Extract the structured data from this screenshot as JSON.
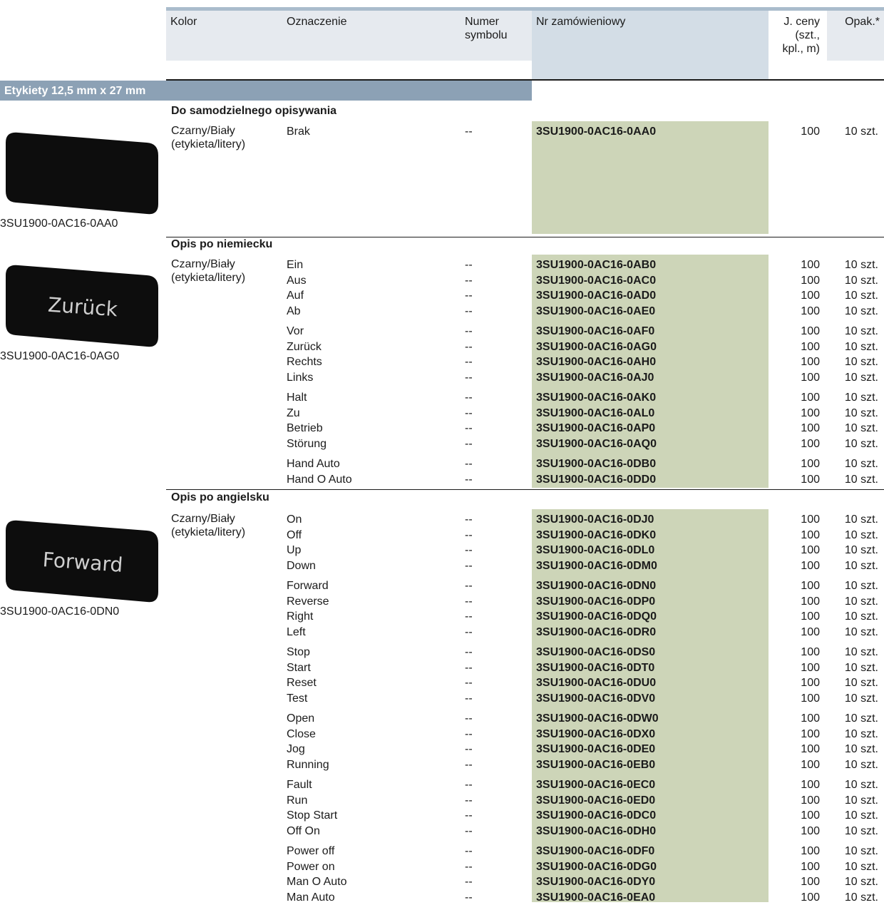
{
  "header": {
    "kolor": "Kolor",
    "oznaczenie": "Oznaczenie",
    "numer_symbolu": [
      "Numer",
      "symbolu"
    ],
    "nr_zamowieniowy": "Nr zamówieniowy",
    "j_ceny": [
      "J. ceny",
      "(szt.,",
      "kpl., m)"
    ],
    "opak": "Opak.*"
  },
  "band_title": "Etykiety 12,5 mm x 27 mm",
  "sections": [
    {
      "title": "Do samodzielnego opisywania",
      "kolor": [
        "Czarny/Biały",
        "(etykieta/litery)"
      ],
      "image_caption": "3SU1900-0AC16-0AA0",
      "image_text": "",
      "groups": [
        [
          {
            "oznaczenie": "Brak",
            "numer": "--",
            "nr": "3SU1900-0AC16-0AA0",
            "cena": "100",
            "opak": "10 szt."
          }
        ]
      ]
    },
    {
      "title": "Opis po niemiecku",
      "kolor": [
        "Czarny/Biały",
        "(etykieta/litery)"
      ],
      "image_caption": "3SU1900-0AC16-0AG0",
      "image_text": "Zurück",
      "groups": [
        [
          {
            "oznaczenie": "Ein",
            "numer": "--",
            "nr": "3SU1900-0AC16-0AB0",
            "cena": "100",
            "opak": "10 szt."
          },
          {
            "oznaczenie": "Aus",
            "numer": "--",
            "nr": "3SU1900-0AC16-0AC0",
            "cena": "100",
            "opak": "10 szt."
          },
          {
            "oznaczenie": "Auf",
            "numer": "--",
            "nr": "3SU1900-0AC16-0AD0",
            "cena": "100",
            "opak": "10 szt."
          },
          {
            "oznaczenie": "Ab",
            "numer": "--",
            "nr": "3SU1900-0AC16-0AE0",
            "cena": "100",
            "opak": "10 szt."
          }
        ],
        [
          {
            "oznaczenie": "Vor",
            "numer": "--",
            "nr": "3SU1900-0AC16-0AF0",
            "cena": "100",
            "opak": "10 szt."
          },
          {
            "oznaczenie": "Zurück",
            "numer": "--",
            "nr": "3SU1900-0AC16-0AG0",
            "cena": "100",
            "opak": "10 szt."
          },
          {
            "oznaczenie": "Rechts",
            "numer": "--",
            "nr": "3SU1900-0AC16-0AH0",
            "cena": "100",
            "opak": "10 szt."
          },
          {
            "oznaczenie": "Links",
            "numer": "--",
            "nr": "3SU1900-0AC16-0AJ0",
            "cena": "100",
            "opak": "10 szt."
          }
        ],
        [
          {
            "oznaczenie": "Halt",
            "numer": "--",
            "nr": "3SU1900-0AC16-0AK0",
            "cena": "100",
            "opak": "10 szt."
          },
          {
            "oznaczenie": "Zu",
            "numer": "--",
            "nr": "3SU1900-0AC16-0AL0",
            "cena": "100",
            "opak": "10 szt."
          },
          {
            "oznaczenie": "Betrieb",
            "numer": "--",
            "nr": "3SU1900-0AC16-0AP0",
            "cena": "100",
            "opak": "10 szt."
          },
          {
            "oznaczenie": "Störung",
            "numer": "--",
            "nr": "3SU1900-0AC16-0AQ0",
            "cena": "100",
            "opak": "10 szt."
          }
        ],
        [
          {
            "oznaczenie": "Hand Auto",
            "numer": "--",
            "nr": "3SU1900-0AC16-0DB0",
            "cena": "100",
            "opak": "10 szt."
          },
          {
            "oznaczenie": "Hand O Auto",
            "numer": "--",
            "nr": "3SU1900-0AC16-0DD0",
            "cena": "100",
            "opak": "10 szt."
          }
        ]
      ]
    },
    {
      "title": "Opis po angielsku",
      "kolor": [
        "Czarny/Biały",
        "(etykieta/litery)"
      ],
      "image_caption": "3SU1900-0AC16-0DN0",
      "image_text": "Forward",
      "groups": [
        [
          {
            "oznaczenie": "On",
            "numer": "--",
            "nr": "3SU1900-0AC16-0DJ0",
            "cena": "100",
            "opak": "10 szt."
          },
          {
            "oznaczenie": "Off",
            "numer": "--",
            "nr": "3SU1900-0AC16-0DK0",
            "cena": "100",
            "opak": "10 szt."
          },
          {
            "oznaczenie": "Up",
            "numer": "--",
            "nr": "3SU1900-0AC16-0DL0",
            "cena": "100",
            "opak": "10 szt."
          },
          {
            "oznaczenie": "Down",
            "numer": "--",
            "nr": "3SU1900-0AC16-0DM0",
            "cena": "100",
            "opak": "10 szt."
          }
        ],
        [
          {
            "oznaczenie": "Forward",
            "numer": "--",
            "nr": "3SU1900-0AC16-0DN0",
            "cena": "100",
            "opak": "10 szt."
          },
          {
            "oznaczenie": "Reverse",
            "numer": "--",
            "nr": "3SU1900-0AC16-0DP0",
            "cena": "100",
            "opak": "10 szt."
          },
          {
            "oznaczenie": "Right",
            "numer": "--",
            "nr": "3SU1900-0AC16-0DQ0",
            "cena": "100",
            "opak": "10 szt."
          },
          {
            "oznaczenie": "Left",
            "numer": "--",
            "nr": "3SU1900-0AC16-0DR0",
            "cena": "100",
            "opak": "10 szt."
          }
        ],
        [
          {
            "oznaczenie": "Stop",
            "numer": "--",
            "nr": "3SU1900-0AC16-0DS0",
            "cena": "100",
            "opak": "10 szt."
          },
          {
            "oznaczenie": "Start",
            "numer": "--",
            "nr": "3SU1900-0AC16-0DT0",
            "cena": "100",
            "opak": "10 szt."
          },
          {
            "oznaczenie": "Reset",
            "numer": "--",
            "nr": "3SU1900-0AC16-0DU0",
            "cena": "100",
            "opak": "10 szt."
          },
          {
            "oznaczenie": "Test",
            "numer": "--",
            "nr": "3SU1900-0AC16-0DV0",
            "cena": "100",
            "opak": "10 szt."
          }
        ],
        [
          {
            "oznaczenie": "Open",
            "numer": "--",
            "nr": "3SU1900-0AC16-0DW0",
            "cena": "100",
            "opak": "10 szt."
          },
          {
            "oznaczenie": "Close",
            "numer": "--",
            "nr": "3SU1900-0AC16-0DX0",
            "cena": "100",
            "opak": "10 szt."
          },
          {
            "oznaczenie": "Jog",
            "numer": "--",
            "nr": "3SU1900-0AC16-0DE0",
            "cena": "100",
            "opak": "10 szt."
          },
          {
            "oznaczenie": "Running",
            "numer": "--",
            "nr": "3SU1900-0AC16-0EB0",
            "cena": "100",
            "opak": "10 szt."
          }
        ],
        [
          {
            "oznaczenie": "Fault",
            "numer": "--",
            "nr": "3SU1900-0AC16-0EC0",
            "cena": "100",
            "opak": "10 szt."
          },
          {
            "oznaczenie": "Run",
            "numer": "--",
            "nr": "3SU1900-0AC16-0ED0",
            "cena": "100",
            "opak": "10 szt."
          },
          {
            "oznaczenie": "Stop Start",
            "numer": "--",
            "nr": "3SU1900-0AC16-0DC0",
            "cena": "100",
            "opak": "10 szt."
          },
          {
            "oznaczenie": "Off On",
            "numer": "--",
            "nr": "3SU1900-0AC16-0DH0",
            "cena": "100",
            "opak": "10 szt."
          }
        ],
        [
          {
            "oznaczenie": "Power off",
            "numer": "--",
            "nr": "3SU1900-0AC16-0DF0",
            "cena": "100",
            "opak": "10 szt."
          },
          {
            "oznaczenie": "Power on",
            "numer": "--",
            "nr": "3SU1900-0AC16-0DG0",
            "cena": "100",
            "opak": "10 szt."
          },
          {
            "oznaczenie": "Man O Auto",
            "numer": "--",
            "nr": "3SU1900-0AC16-0DY0",
            "cena": "100",
            "opak": "10 szt."
          },
          {
            "oznaczenie": "Man Auto",
            "numer": "--",
            "nr": "3SU1900-0AC16-0EA0",
            "cena": "100",
            "opak": "10 szt."
          }
        ]
      ]
    }
  ]
}
